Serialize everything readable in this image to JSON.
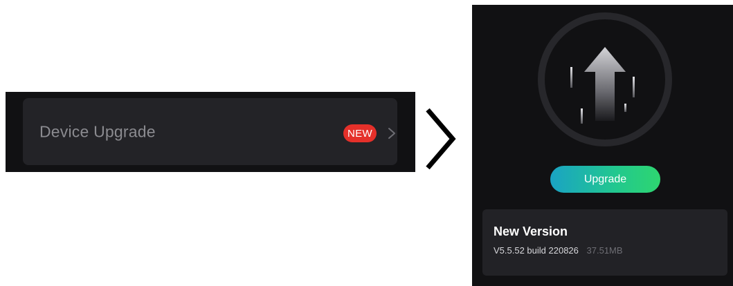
{
  "menu": {
    "item_label": "Device Upgrade",
    "badge": "NEW"
  },
  "screen": {
    "upgrade_button_label": "Upgrade",
    "version_card": {
      "title": "New Version",
      "build": "V5.5.52 build 220826",
      "size": "37.51MB"
    }
  },
  "colors": {
    "dark_bg": "#111113",
    "row_bg": "#232327",
    "badge_red": "#e5302a",
    "button_gradient_start": "#1aa3c4",
    "button_gradient_end": "#2ed670"
  },
  "icons": [
    "chevron-right-icon",
    "transition-arrow-icon",
    "upgrade-arrow-icon"
  ]
}
